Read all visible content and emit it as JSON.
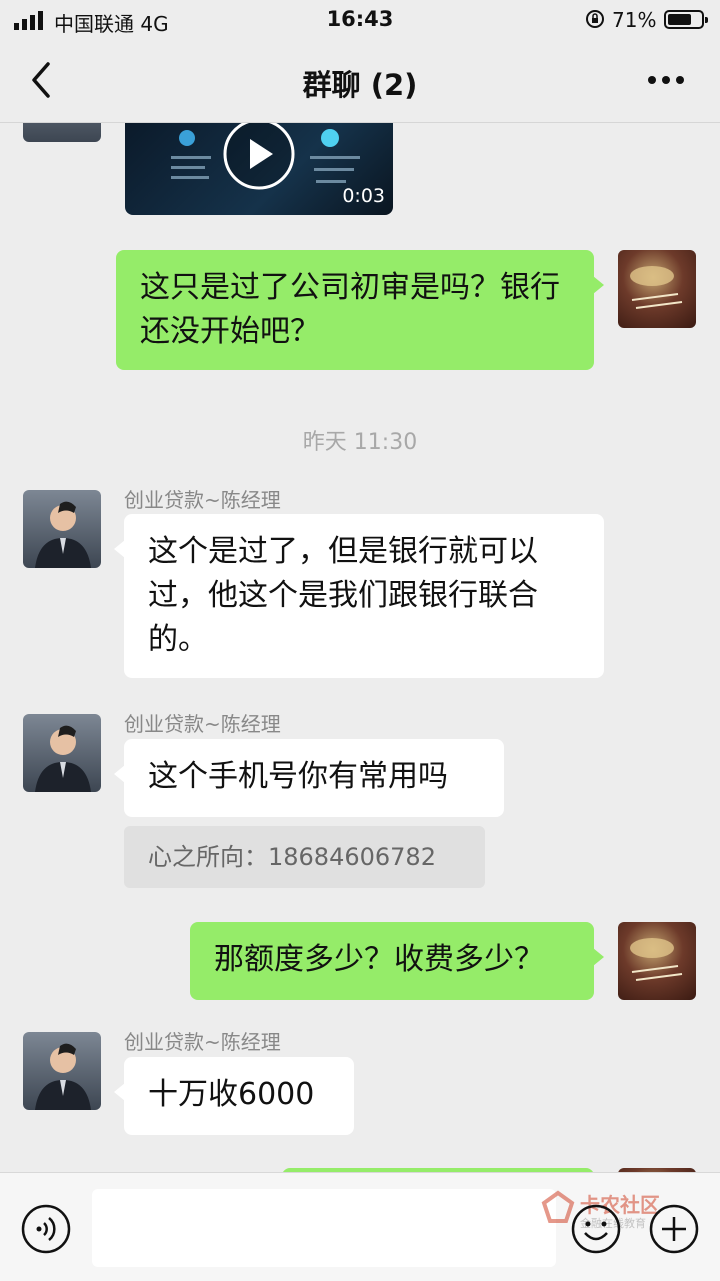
{
  "status_bar": {
    "carrier": "中国联通  4G",
    "time": "16:43",
    "battery_percent": "71%",
    "battery_level": 0.71
  },
  "nav": {
    "title": "群聊 (2)"
  },
  "video": {
    "duration": "0:03"
  },
  "messages": {
    "m1": {
      "text": "这只是过了公司初审是吗？银行还没开始吧？"
    },
    "timestamp": "昨天 11:30",
    "m2": {
      "sender": "创业贷款~陈经理",
      "text": "这个是过了，但是银行就可以过，他这个是我们跟银行联合的。"
    },
    "m3": {
      "sender": "创业贷款~陈经理",
      "text": "这个手机号你有常用吗",
      "quote": "心之所向：18684606782"
    },
    "m4": {
      "text": "那额度多少？收费多少？"
    },
    "m5": {
      "sender": "创业贷款~陈经理",
      "text": "十万收6000"
    }
  },
  "watermark": {
    "title": "卡农社区",
    "subtitle": "金融在线教育"
  },
  "colors": {
    "background": "#ededed",
    "sent_bubble": "#95ec69",
    "received_bubble": "#ffffff"
  }
}
